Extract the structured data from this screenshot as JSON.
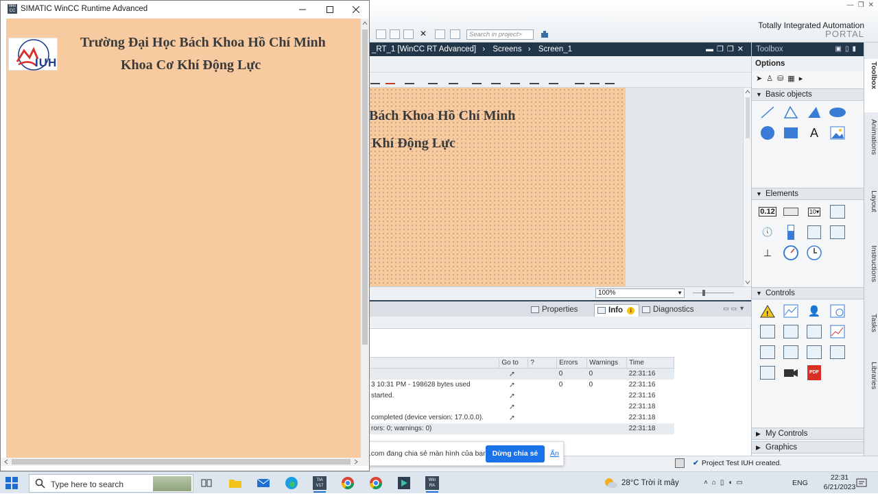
{
  "tia": {
    "brand_title": "Totally Integrated Automation",
    "brand_sub": "PORTAL",
    "search_placeholder": "Search in project>",
    "editor_title": {
      "crumb1": "_RT_1 [WinCC RT Advanced]",
      "sep": "›",
      "crumb2": "Screens",
      "crumb3": "Screen_1"
    },
    "canvas": {
      "line1": "Bách Khoa Hồ Chí Minh",
      "line2": "Khí Động Lực"
    },
    "zoom": "100%",
    "inspector": {
      "tabs": [
        "Properties",
        "Info",
        "Diagnostics"
      ]
    },
    "log": {
      "columns": [
        "Go to",
        "?",
        "Errors",
        "Warnings",
        "Time"
      ],
      "rows": [
        {
          "message": "",
          "errors": "0",
          "warnings": "0",
          "time": "22:31:16"
        },
        {
          "message": "3 10:31 PM - 198628 bytes used",
          "errors": "0",
          "warnings": "0",
          "time": "22:31:16"
        },
        {
          "message": "started.",
          "errors": "",
          "warnings": "",
          "time": "22:31:16"
        },
        {
          "message": "",
          "errors": "",
          "warnings": "",
          "time": "22:31:18"
        },
        {
          "message": "completed (device version: 17.0.0.0).",
          "errors": "",
          "warnings": "",
          "time": "22:31:18"
        },
        {
          "message": "rors: 0; warnings: 0)",
          "errors": "",
          "warnings": "",
          "time": "22:31:18"
        }
      ]
    },
    "toolbox": {
      "title": "Toolbox",
      "options": "Options",
      "sections": [
        "Basic objects",
        "Elements",
        "Controls",
        "My Controls",
        "Graphics"
      ]
    },
    "vtabs": [
      "Toolbox",
      "Animations",
      "Layout",
      "Instructions",
      "Tasks",
      "Libraries"
    ],
    "status_message": "Project Test IUH created."
  },
  "meet": {
    "text": "meet.google.com đang chia sẻ màn hình của bạn.",
    "stop_label": "Dừng chia sẻ",
    "hide_label": "Ẩn"
  },
  "runtime": {
    "window_title": "SIMATIC WinCC Runtime Advanced",
    "heading1": "Trường Đại Học Bách Khoa Hồ Chí Minh",
    "heading2": "Khoa Cơ Khí Động Lực",
    "logo_text": "IUH"
  },
  "taskbar": {
    "search_placeholder": "Type here to search",
    "weather": "28°C  Trời ít mây",
    "language": "ENG",
    "time": "22:31",
    "date": "6/21/2023"
  },
  "colors": {
    "screen_bg": "#f7caa0",
    "tia_dark": "#22364a",
    "meet_blue": "#1a73e8"
  }
}
